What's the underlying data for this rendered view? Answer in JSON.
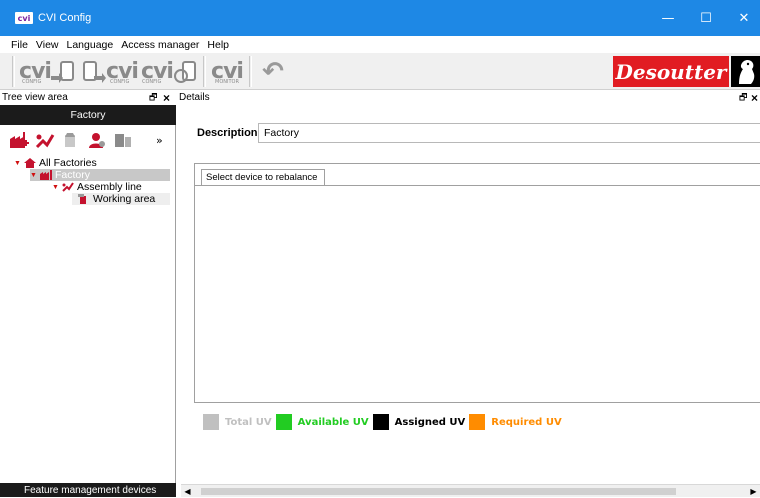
{
  "window": {
    "title": "CVI Config",
    "logo_text": "cvi",
    "minimize": "—",
    "maximize": "☐",
    "close": "✕"
  },
  "menu": [
    "File",
    "View",
    "Language",
    "Access manager",
    "Help"
  ],
  "toolbar": {
    "brand": "Desoutter",
    "buttons": [
      {
        "name": "cvi-config-send-button",
        "label": "cvi",
        "sub": "CONFIG"
      },
      {
        "name": "cvi-config-receive-button",
        "label": "cvi",
        "sub": "CONFIG"
      },
      {
        "name": "cvi-config-sync-button",
        "label": "cvi",
        "sub": "CONFIG"
      },
      {
        "name": "cvi-monitor-button",
        "label": "cvi",
        "sub": "MONITOR"
      },
      {
        "name": "undo-button",
        "label": "↶"
      }
    ]
  },
  "left_panel": {
    "header": "Tree view area",
    "float_icon": "🗗",
    "close_icon": "×",
    "title": "Factory",
    "more": "»",
    "tree": [
      {
        "label": "All Factories",
        "level": 0,
        "icon": "home-icon"
      },
      {
        "label": "Factory",
        "level": 1,
        "icon": "factory-icon",
        "selected": true
      },
      {
        "label": "Assembly line",
        "level": 2,
        "icon": "assembly-line-icon"
      },
      {
        "label": "Working area",
        "level": 3,
        "icon": "working-area-icon"
      }
    ],
    "footer": "Feature management devices"
  },
  "details_panel": {
    "header": "Details",
    "float_icon": "🗗",
    "close_icon": "×",
    "description_label": "Description",
    "description_value": "Factory",
    "grid_column": "Select device to rebalance",
    "legend": [
      {
        "label": "Total UV",
        "color": "#c0c0c0"
      },
      {
        "label": "Available UV",
        "color": "#22cc22"
      },
      {
        "label": "Assigned UV",
        "color": "#000000"
      },
      {
        "label": "Required UV",
        "color": "#ff8c00"
      }
    ]
  },
  "scrollbar": {
    "left": "◀",
    "right": "▶"
  }
}
